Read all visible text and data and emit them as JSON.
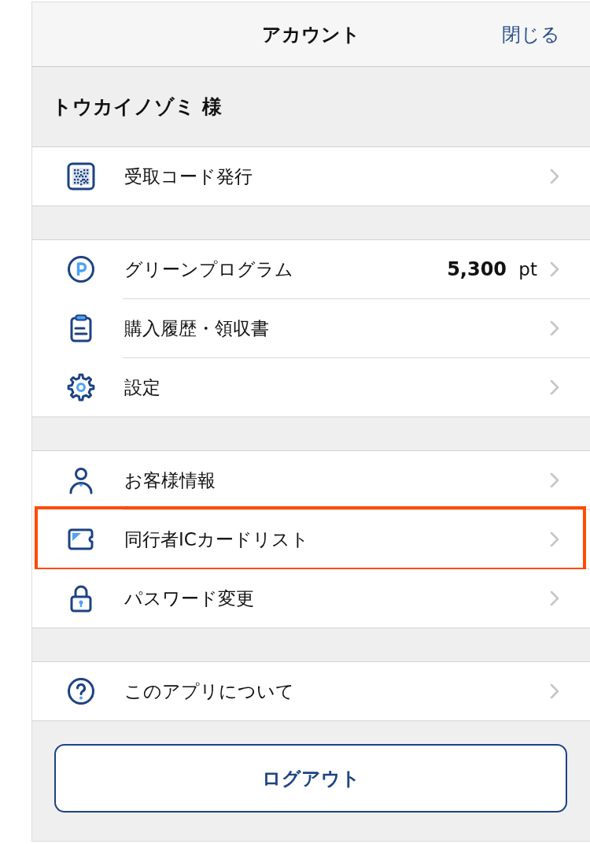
{
  "header": {
    "title": "アカウント",
    "close": "閉じる"
  },
  "user": {
    "name": "トウカイノゾミ 様"
  },
  "groups": [
    {
      "items": [
        {
          "kind": "receive-code",
          "label": "受取コード発行",
          "highlighted": false
        }
      ]
    },
    {
      "items": [
        {
          "kind": "points",
          "label": "グリーンプログラム",
          "value": "5,300",
          "unit": "pt",
          "highlighted": false
        },
        {
          "kind": "history",
          "label": "購入履歴・領収書",
          "highlighted": false
        },
        {
          "kind": "settings",
          "label": "設定",
          "highlighted": false
        }
      ]
    },
    {
      "items": [
        {
          "kind": "profile",
          "label": "お客様情報",
          "highlighted": false
        },
        {
          "kind": "ic-card",
          "label": "同行者ICカードリスト",
          "highlighted": true
        },
        {
          "kind": "password",
          "label": "パスワード変更",
          "highlighted": false
        }
      ]
    },
    {
      "items": [
        {
          "kind": "about",
          "label": "このアプリについて",
          "highlighted": false
        }
      ]
    }
  ],
  "logout_button": "ログアウト"
}
